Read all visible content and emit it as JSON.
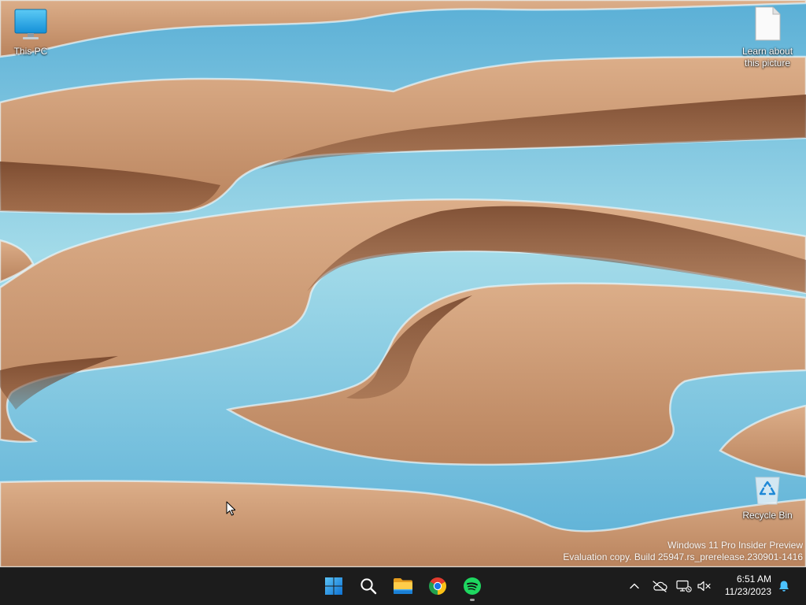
{
  "desktop": {
    "this_pc": {
      "label": "This PC",
      "icon": "this-pc-icon"
    },
    "learn_about_picture": {
      "label": "Learn about this picture",
      "icon": "document-icon"
    },
    "recycle_bin": {
      "label": "Recycle Bin",
      "icon": "recycle-bin-icon"
    }
  },
  "watermark": {
    "line1": "Windows 11 Pro Insider Preview",
    "line2": "Evaluation copy. Build 25947.rs_prerelease.230901-1416"
  },
  "taskbar": {
    "pinned": [
      {
        "icon": "windows-start-icon",
        "running": false
      },
      {
        "icon": "search-icon",
        "running": false
      },
      {
        "icon": "file-explorer-icon",
        "running": false
      },
      {
        "icon": "chrome-icon",
        "running": false
      },
      {
        "icon": "spotify-icon",
        "running": true
      }
    ],
    "tray": {
      "icons": [
        "chevron-up-icon",
        "onedrive-offline-icon",
        "network-icon",
        "volume-muted-icon"
      ],
      "clock": {
        "time": "6:51 AM",
        "date": "11/23/2023"
      },
      "notification_icon": "bell-icon"
    }
  },
  "cursor_icon": "mouse-pointer-icon",
  "colors": {
    "taskbar_background": "#1c1c1c",
    "accent": "#4cc2ff",
    "water": "#a3dbe9",
    "water_deep": "#5aafd6",
    "sand_light": "#dcae89",
    "sand": "#b9835d",
    "sand_shadow": "#6b3b22"
  }
}
